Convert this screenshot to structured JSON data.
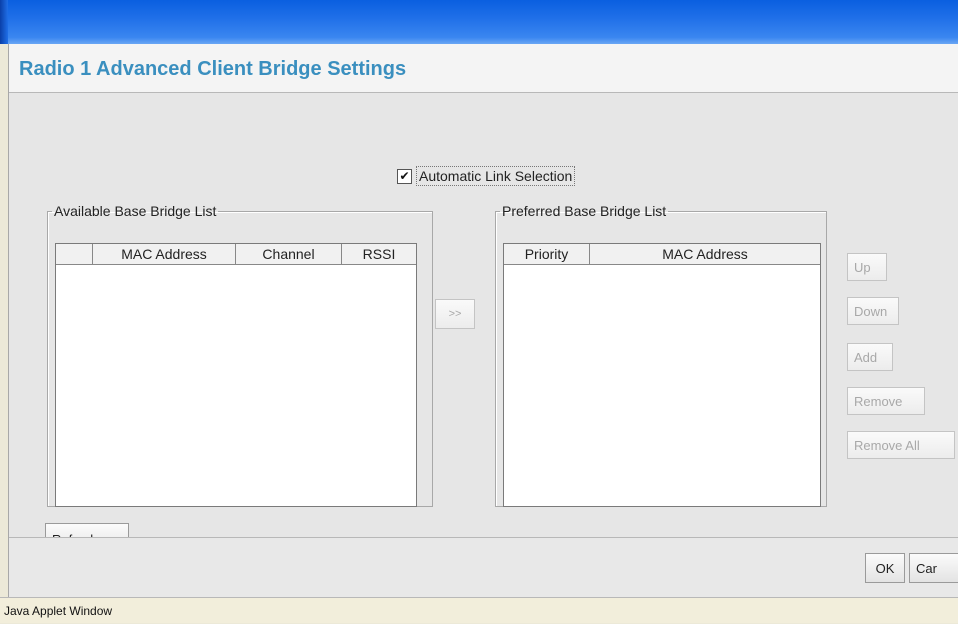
{
  "window": {
    "title": "Radio 1 Advanced Client Bridge Settings",
    "status_text": "Java Applet Window"
  },
  "auto_link": {
    "label": "Automatic Link Selection",
    "checked": true,
    "check_glyph": "✔"
  },
  "available_list": {
    "legend": "Available Base Bridge List",
    "columns": [
      "",
      "MAC Address",
      "Channel",
      "RSSI"
    ],
    "rows": []
  },
  "preferred_list": {
    "legend": "Preferred Base Bridge List",
    "columns": [
      "Priority",
      "MAC Address"
    ],
    "rows": []
  },
  "buttons": {
    "move": ">>",
    "up": "Up",
    "down": "Down",
    "add": "Add",
    "remove": "Remove",
    "remove_all": "Remove All",
    "refresh": "Refresh",
    "ok": "OK",
    "cancel": "Car"
  }
}
